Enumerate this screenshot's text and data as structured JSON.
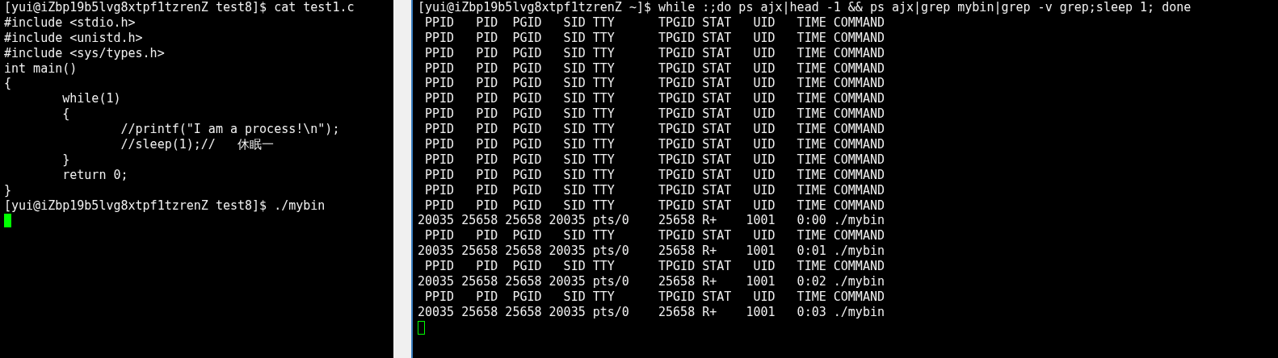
{
  "panes": [
    {
      "lines": [
        "[yui@iZbp19b5lvg8xtpf1tzrenZ test8]$ cat test1.c",
        "#include <stdio.h>",
        "#include <unistd.h>",
        "#include <sys/types.h>",
        "int main()",
        "{",
        "        while(1)",
        "        {",
        "                //printf(\"I am a process!\\n\");",
        "                //sleep(1);//   休眠一",
        "        }",
        "        return 0;",
        "}",
        "[yui@iZbp19b5lvg8xtpf1tzrenZ test8]$ ./mybin"
      ],
      "cursor": {
        "focused": true
      }
    },
    {
      "lines": [
        "[yui@iZbp19b5lvg8xtpf1tzrenZ ~]$ while :;do ps ajx|head -1 && ps ajx|grep mybin|grep -v grep;sleep 1; done",
        " PPID   PID  PGID   SID TTY      TPGID STAT   UID   TIME COMMAND",
        " PPID   PID  PGID   SID TTY      TPGID STAT   UID   TIME COMMAND",
        " PPID   PID  PGID   SID TTY      TPGID STAT   UID   TIME COMMAND",
        " PPID   PID  PGID   SID TTY      TPGID STAT   UID   TIME COMMAND",
        " PPID   PID  PGID   SID TTY      TPGID STAT   UID   TIME COMMAND",
        " PPID   PID  PGID   SID TTY      TPGID STAT   UID   TIME COMMAND",
        " PPID   PID  PGID   SID TTY      TPGID STAT   UID   TIME COMMAND",
        " PPID   PID  PGID   SID TTY      TPGID STAT   UID   TIME COMMAND",
        " PPID   PID  PGID   SID TTY      TPGID STAT   UID   TIME COMMAND",
        " PPID   PID  PGID   SID TTY      TPGID STAT   UID   TIME COMMAND",
        " PPID   PID  PGID   SID TTY      TPGID STAT   UID   TIME COMMAND",
        " PPID   PID  PGID   SID TTY      TPGID STAT   UID   TIME COMMAND",
        " PPID   PID  PGID   SID TTY      TPGID STAT   UID   TIME COMMAND",
        "20035 25658 25658 20035 pts/0    25658 R+    1001   0:00 ./mybin",
        " PPID   PID  PGID   SID TTY      TPGID STAT   UID   TIME COMMAND",
        "20035 25658 25658 20035 pts/0    25658 R+    1001   0:01 ./mybin",
        " PPID   PID  PGID   SID TTY      TPGID STAT   UID   TIME COMMAND",
        "20035 25658 25658 20035 pts/0    25658 R+    1001   0:02 ./mybin",
        " PPID   PID  PGID   SID TTY      TPGID STAT   UID   TIME COMMAND",
        "20035 25658 25658 20035 pts/0    25658 R+    1001   0:03 ./mybin"
      ],
      "cursor": {
        "focused": false
      }
    }
  ]
}
